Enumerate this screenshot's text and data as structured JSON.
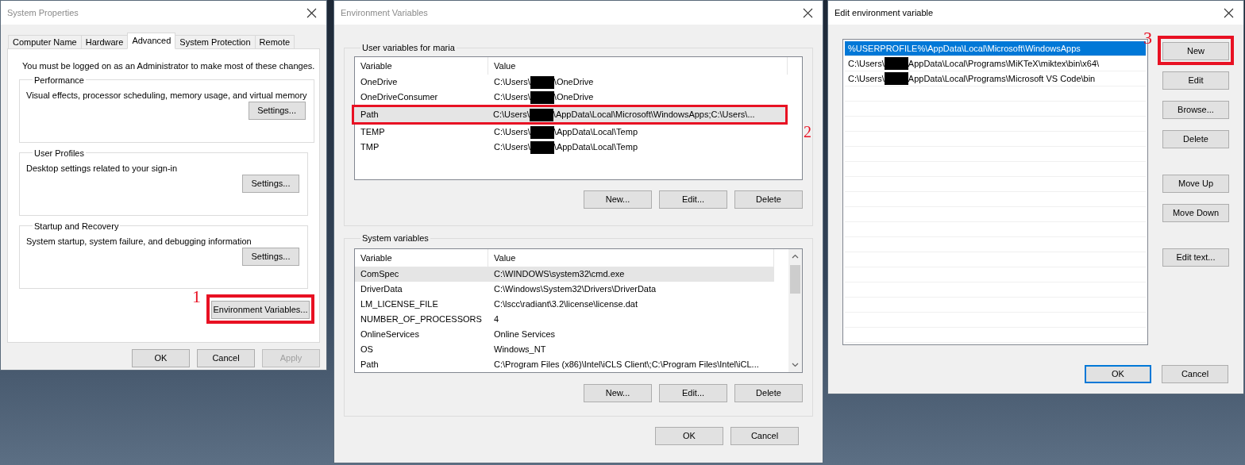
{
  "system_properties": {
    "title": "System Properties",
    "active": false,
    "tabs": [
      {
        "label": "Computer Name",
        "selected": false
      },
      {
        "label": "Hardware",
        "selected": false
      },
      {
        "label": "Advanced",
        "selected": true
      },
      {
        "label": "System Protection",
        "selected": false
      },
      {
        "label": "Remote",
        "selected": false
      }
    ],
    "notice": "You must be logged on as an Administrator to make most of these changes.",
    "groups": [
      {
        "title": "Performance",
        "description": "Visual effects, processor scheduling, memory usage, and virtual memory",
        "button": "Settings..."
      },
      {
        "title": "User Profiles",
        "description": "Desktop settings related to your sign-in",
        "button": "Settings..."
      },
      {
        "title": "Startup and Recovery",
        "description": "System startup, system failure, and debugging information",
        "button": "Settings..."
      }
    ],
    "env_button": {
      "label": "Environment Variables...",
      "callout": "1"
    },
    "buttons": [
      {
        "label": "OK",
        "disabled": false
      },
      {
        "label": "Cancel",
        "disabled": false
      },
      {
        "label": "Apply",
        "disabled": true
      }
    ]
  },
  "environment_variables": {
    "title": "Environment Variables",
    "active": false,
    "user_group": {
      "title": "User variables for maria",
      "columns": [
        "Variable",
        "Value"
      ],
      "rows": [
        {
          "variable": "OneDrive",
          "value_parts": [
            "C:\\Users\\",
            "\\OneDrive"
          ],
          "selected": false
        },
        {
          "variable": "OneDriveConsumer",
          "value_parts": [
            "C:\\Users\\",
            "\\OneDrive"
          ],
          "selected": false
        },
        {
          "variable": "Path",
          "value_parts": [
            "C:\\Users\\",
            "\\AppData\\Local\\Microsoft\\WindowsApps;C:\\Users\\..."
          ],
          "selected": true,
          "callout": "2"
        },
        {
          "variable": "TEMP",
          "value_parts": [
            "C:\\Users\\",
            "\\AppData\\Local\\Temp"
          ],
          "selected": false
        },
        {
          "variable": "TMP",
          "value_parts": [
            "C:\\Users\\",
            "\\AppData\\Local\\Temp"
          ],
          "selected": false
        }
      ],
      "buttons": [
        "New...",
        "Edit...",
        "Delete"
      ]
    },
    "system_group": {
      "title": "System variables",
      "columns": [
        "Variable",
        "Value"
      ],
      "rows": [
        {
          "variable": "ComSpec",
          "value_parts": [
            "C:\\WINDOWS\\system32\\cmd.exe"
          ],
          "selected": true
        },
        {
          "variable": "DriverData",
          "value_parts": [
            "C:\\Windows\\System32\\Drivers\\DriverData"
          ],
          "selected": false
        },
        {
          "variable": "LM_LICENSE_FILE",
          "value_parts": [
            "C:\\lscc\\radiant\\3.2\\license\\license.dat"
          ],
          "selected": false
        },
        {
          "variable": "NUMBER_OF_PROCESSORS",
          "value_parts": [
            "4"
          ],
          "selected": false
        },
        {
          "variable": "OnlineServices",
          "value_parts": [
            "Online Services"
          ],
          "selected": false
        },
        {
          "variable": "OS",
          "value_parts": [
            "Windows_NT"
          ],
          "selected": false
        },
        {
          "variable": "Path",
          "value_parts": [
            "C:\\Program Files (x86)\\Intel\\iCLS Client\\;C:\\Program Files\\Intel\\iCL..."
          ],
          "selected": false
        }
      ],
      "buttons": [
        "New...",
        "Edit...",
        "Delete"
      ]
    },
    "buttons": [
      {
        "label": "OK"
      },
      {
        "label": "Cancel"
      }
    ]
  },
  "edit_variable": {
    "title": "Edit environment variable",
    "active": true,
    "entries": [
      {
        "text_parts": [
          "%USERPROFILE%\\AppData\\Local\\Microsoft\\WindowsApps"
        ],
        "selected": true
      },
      {
        "text_parts": [
          "C:\\Users\\",
          "AppData\\Local\\Programs\\MiKTeX\\miktex\\bin\\x64\\"
        ],
        "selected": false
      },
      {
        "text_parts": [
          "C:\\Users\\",
          "AppData\\Local\\Programs\\Microsoft VS Code\\bin"
        ],
        "selected": false
      }
    ],
    "button_groups": [
      [
        {
          "label": "New",
          "callout": "3"
        },
        {
          "label": "Edit"
        },
        {
          "label": "Browse..."
        },
        {
          "label": "Delete"
        }
      ],
      [
        {
          "label": "Move Up"
        },
        {
          "label": "Move Down"
        }
      ],
      [
        {
          "label": "Edit text..."
        }
      ]
    ],
    "footer_buttons": [
      {
        "label": "OK",
        "default": true
      },
      {
        "label": "Cancel",
        "default": false
      }
    ]
  }
}
